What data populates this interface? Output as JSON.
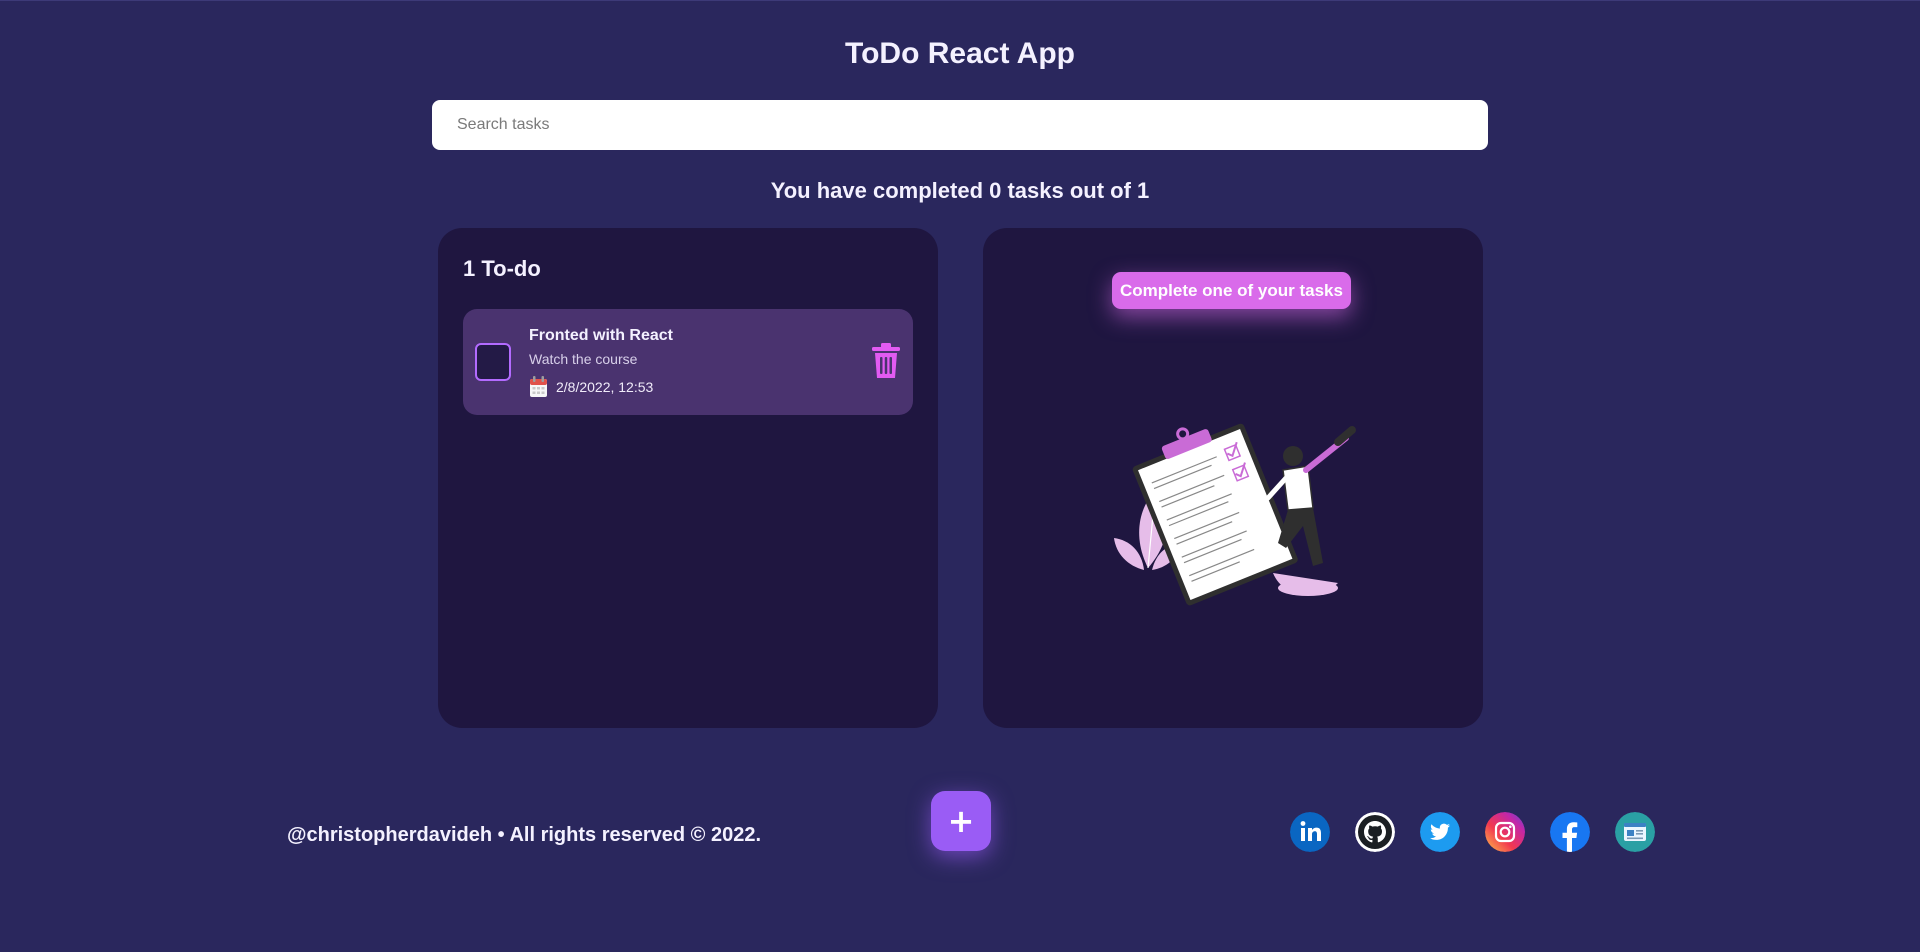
{
  "app": {
    "title": "ToDo React App"
  },
  "search": {
    "placeholder": "Search tasks",
    "value": ""
  },
  "counter": {
    "text": "You have completed 0 tasks out of 1"
  },
  "todo_panel": {
    "heading": "1 To-do",
    "items": [
      {
        "title": "Fronted with React",
        "description": "Watch the course",
        "date": "2/8/2022, 12:53",
        "completed": false
      }
    ]
  },
  "hint_panel": {
    "badge": "Complete one of your tasks"
  },
  "footer": {
    "credit": "@christopherdavideh • All rights reserved © 2022.",
    "add_button_label": "+",
    "socials": [
      "linkedin-icon",
      "github-icon",
      "twitter-icon",
      "instagram-icon",
      "facebook-icon",
      "portfolio-icon"
    ]
  },
  "colors": {
    "background": "#2a275d",
    "panel": "#1f1640",
    "todo_item": "#4a336f",
    "accent": "#d96bea",
    "add_button": "#9a5cf5"
  }
}
